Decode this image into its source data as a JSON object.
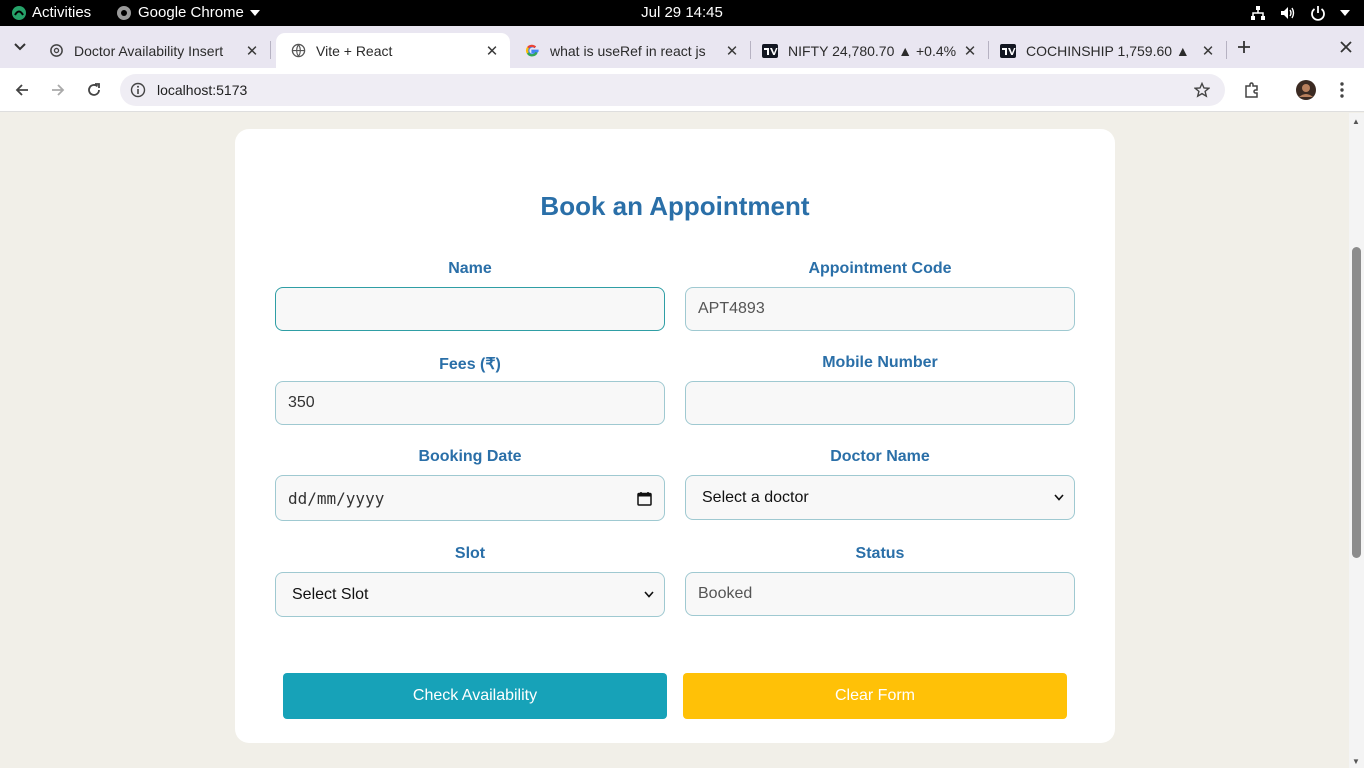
{
  "system": {
    "activities": "Activities",
    "app_name": "Google Chrome",
    "clock": "Jul 29  14:45"
  },
  "tabs": [
    {
      "title": "Doctor Availability Insert",
      "active": false
    },
    {
      "title": "Vite + React",
      "active": true
    },
    {
      "title": "what is useRef in react js",
      "active": false
    },
    {
      "title": "NIFTY 24,780.70 ▲ +0.4%",
      "active": false
    },
    {
      "title": "COCHINSHIP 1,759.60 ▲",
      "active": false
    }
  ],
  "toolbar": {
    "url": "localhost:5173"
  },
  "form": {
    "title": "Book an Appointment",
    "name": {
      "label": "Name",
      "value": ""
    },
    "appointment_code": {
      "label": "Appointment Code",
      "value": "APT4893"
    },
    "fees": {
      "label": "Fees (₹)",
      "value": "350"
    },
    "mobile": {
      "label": "Mobile Number",
      "value": ""
    },
    "booking_date": {
      "label": "Booking Date",
      "placeholder": "dd/mm/yyyy"
    },
    "doctor": {
      "label": "Doctor Name",
      "selected": "Select a doctor"
    },
    "slot": {
      "label": "Slot",
      "selected": "Select Slot"
    },
    "status": {
      "label": "Status",
      "value": "Booked"
    },
    "check_button": "Check Availability",
    "clear_button": "Clear Form"
  },
  "colors": {
    "heading": "#2a6fa8",
    "check_button": "#17a2b8",
    "clear_button": "#ffc107",
    "page_bg": "#f1efe8"
  }
}
